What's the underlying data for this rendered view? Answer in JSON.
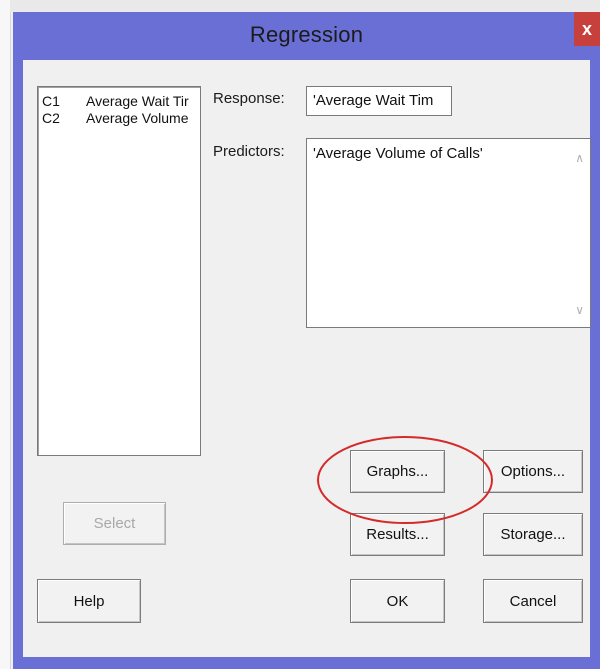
{
  "dialog": {
    "title": "Regression",
    "close_glyph": "x"
  },
  "variables": [
    {
      "id": "C1",
      "name": "Average Wait Tir"
    },
    {
      "id": "C2",
      "name": "Average Volume"
    }
  ],
  "response": {
    "label": "Response:",
    "value": "'Average Wait Tim"
  },
  "predictors": {
    "label": "Predictors:",
    "value": "'Average Volume of Calls'"
  },
  "buttons": {
    "select": "Select",
    "help": "Help",
    "graphs": "Graphs...",
    "options": "Options...",
    "results": "Results...",
    "storage": "Storage...",
    "ok": "OK",
    "cancel": "Cancel"
  },
  "colors": {
    "title_bar": "#6a6fd6",
    "close_button": "#c8403b",
    "highlight_circle": "#d42a2a"
  }
}
